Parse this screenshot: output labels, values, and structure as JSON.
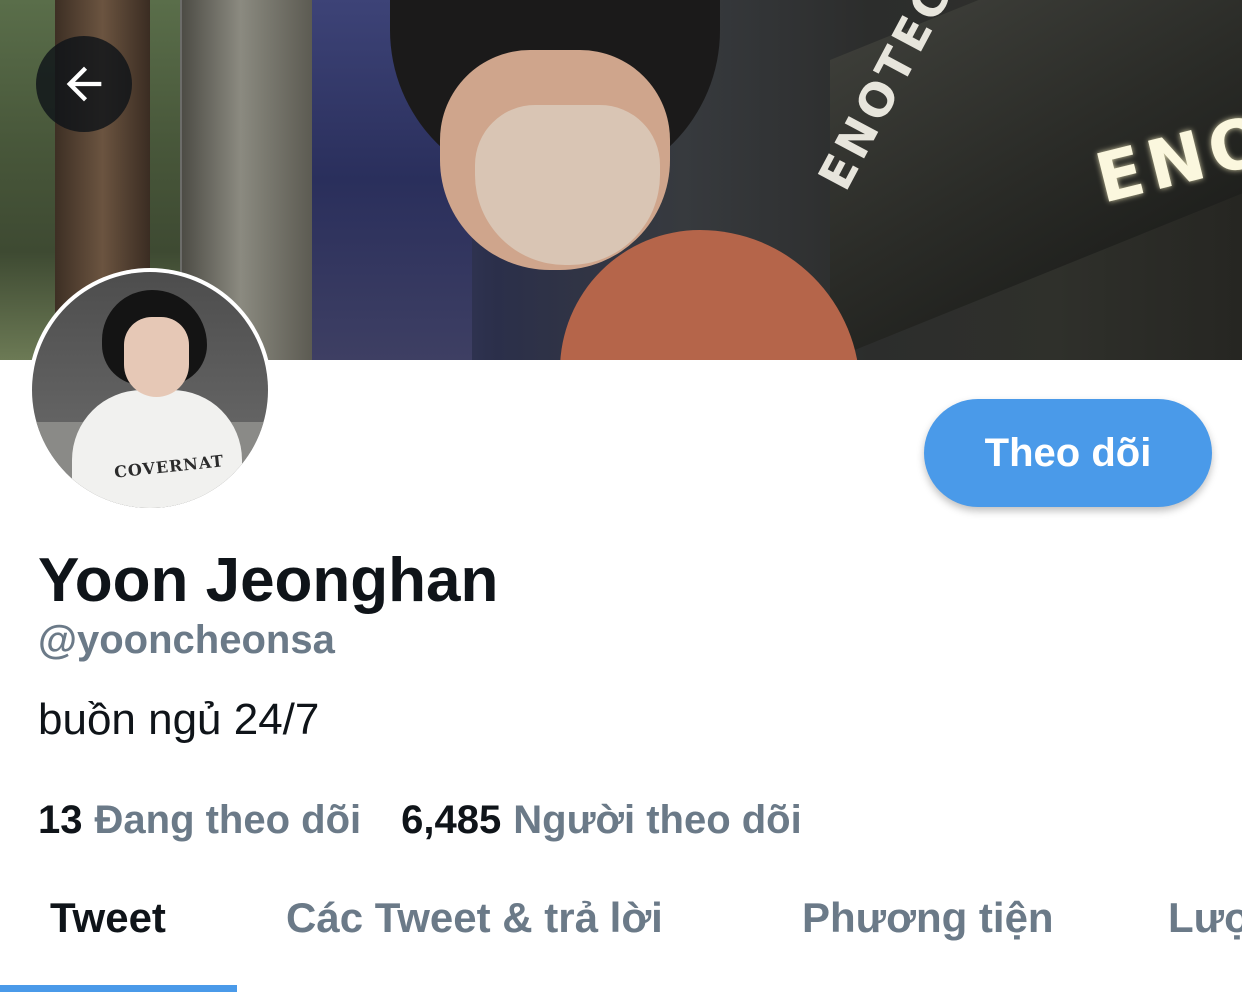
{
  "profile": {
    "name": "Yoon Jeonghan",
    "handle": "@yooncheonsa",
    "bio": "buồn ngủ 24/7",
    "following_count": "13",
    "following_label": "Đang theo dõi",
    "followers_count": "6,485",
    "followers_label": "Người theo dõi"
  },
  "actions": {
    "follow_label": "Theo dõi"
  },
  "tabs": [
    {
      "label": "Tweet",
      "active": true
    },
    {
      "label": "Các Tweet & trả lời",
      "active": false
    },
    {
      "label": "Phương tiện",
      "active": false
    },
    {
      "label": "Lượt thích",
      "active": false
    }
  ],
  "banner": {
    "sign_text": "ENO",
    "sign_text_2": "ENOTECA"
  },
  "avatar": {
    "shirt_text": "COVERNAT"
  },
  "icons": {
    "back": "arrow-left-icon"
  },
  "colors": {
    "accent": "#4a9ae9",
    "secondary_text": "#6b7a88",
    "primary_text": "#0f1419"
  }
}
